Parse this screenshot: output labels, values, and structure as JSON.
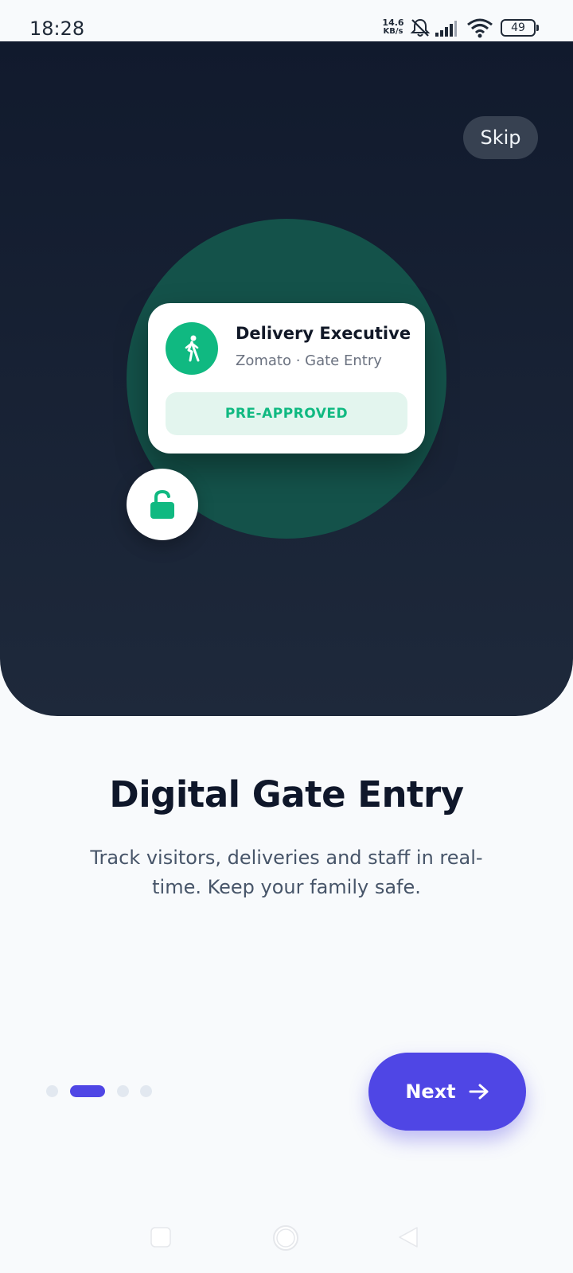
{
  "status_bar": {
    "time": "18:28",
    "net_speed_value": "14.6",
    "net_speed_unit": "KB/s",
    "battery": "49"
  },
  "hero": {
    "skip_label": "Skip",
    "card": {
      "title": "Delivery Executive",
      "subtitle": "Zomato · Gate Entry",
      "badge": "PRE-APPROVED",
      "avatar_icon": "walking-person-icon"
    },
    "lock_icon": "unlocked-padlock-icon"
  },
  "content": {
    "title": "Digital Gate Entry",
    "description": "Track visitors, deliveries and staff in real-time. Keep your family safe."
  },
  "pagination": {
    "total": 4,
    "active_index": 1
  },
  "next_button": {
    "label": "Next",
    "icon": "arrow-right-icon"
  },
  "colors": {
    "accent": "#4f46e5",
    "success": "#10b981",
    "hero_dark": "#111a2d"
  }
}
